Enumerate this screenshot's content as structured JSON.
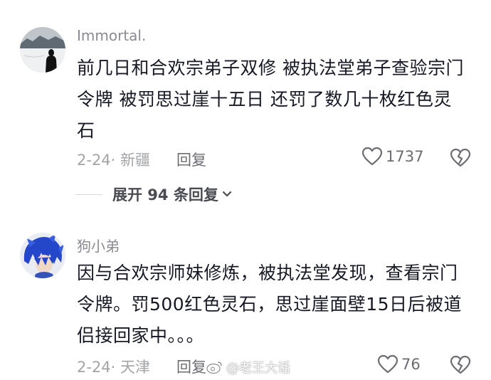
{
  "comments": [
    {
      "username": "Immortal.",
      "lines": [
        "前几日和合欢宗弟子双修 被执法堂弟子查验宗门",
        "令牌 被罚思过崖十五日  还罚了数几十枚红色灵",
        "石"
      ],
      "meta": "2-24· 新疆",
      "reply_label": "回复",
      "likes": "1737",
      "expand_label": "展开 94 条回复"
    },
    {
      "username": "狗小弟",
      "lines": [
        "因与合欢宗师妹修炼，被执法堂发现，查看宗门",
        "令牌。罚500红色灵石，思过崖面壁15日后被道",
        "侣接回家中。。。"
      ],
      "meta": "2-24· 天津",
      "reply_label": "回复",
      "likes": "76"
    }
  ],
  "watermark": "@老王大话",
  "icons": {
    "like": "heart-outline-icon",
    "dislike": "broken-heart-icon",
    "expand": "chevron-down-icon"
  }
}
